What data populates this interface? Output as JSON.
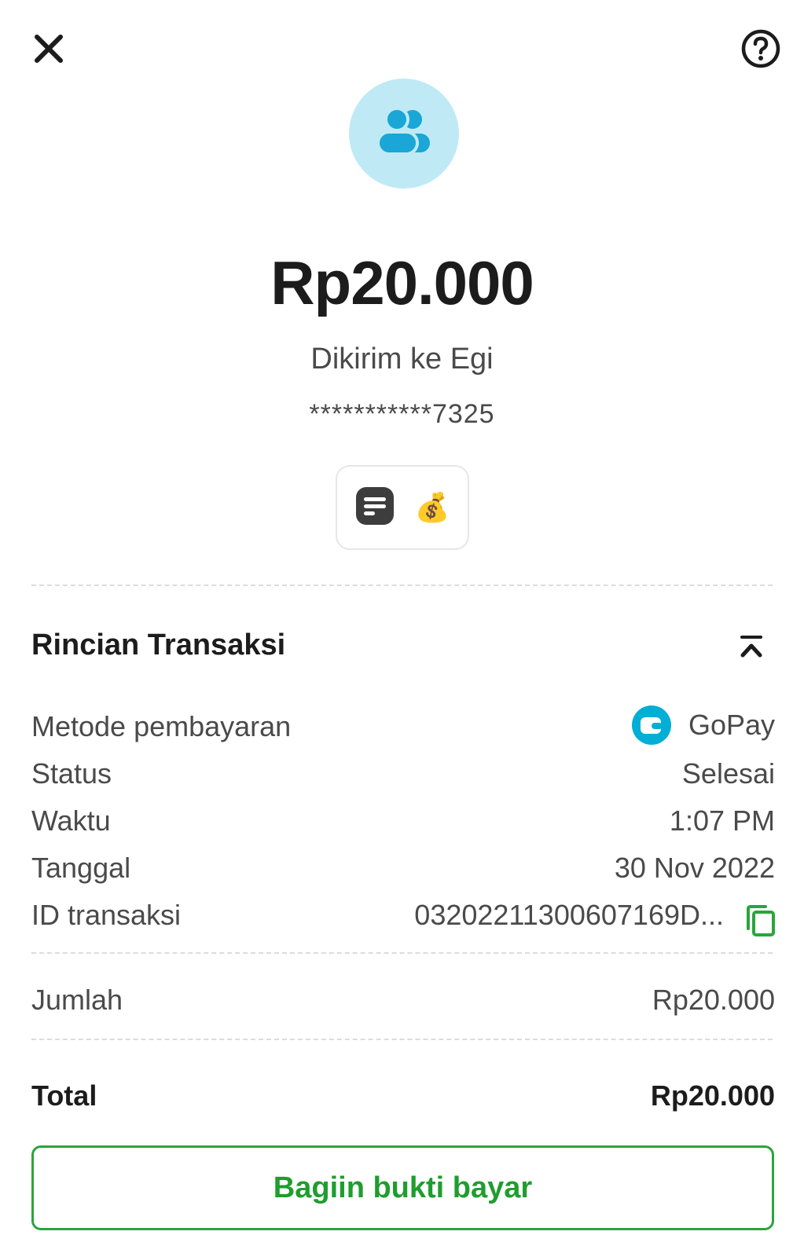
{
  "header": {
    "close_icon": "close-icon",
    "help_icon": "help-icon"
  },
  "recipient_avatar_icon": "users-icon",
  "transfer": {
    "amount": "Rp20.000",
    "recipient_text": "Dikirim ke Egi",
    "account_masked": "***********7325"
  },
  "note": {
    "note_icon": "note-icon",
    "emoji": "💰"
  },
  "details": {
    "title": "Rincian Transaksi",
    "collapse_icon": "chevron-up-double-icon",
    "rows": [
      {
        "label": "Metode pembayaran",
        "value": "GoPay",
        "icon": "gopay-wallet-icon"
      },
      {
        "label": "Status",
        "value": "Selesai"
      },
      {
        "label": "Waktu",
        "value": "1:07 PM"
      },
      {
        "label": "Tanggal",
        "value": "30 Nov 2022"
      },
      {
        "label": "ID transaksi",
        "value": "032022113006071​69D...",
        "icon": "copy-icon"
      }
    ]
  },
  "amount_row": {
    "label": "Jumlah",
    "value": "Rp20.000"
  },
  "total_row": {
    "label": "Total",
    "value": "Rp20.000"
  },
  "share_button": {
    "label": "Bagiin bukti bayar"
  },
  "colors": {
    "accent_green": "#2aa53b",
    "avatar_bg": "#bfeaf5",
    "avatar_icon": "#1aa6d6",
    "gopay_blue": "#00aed6"
  }
}
